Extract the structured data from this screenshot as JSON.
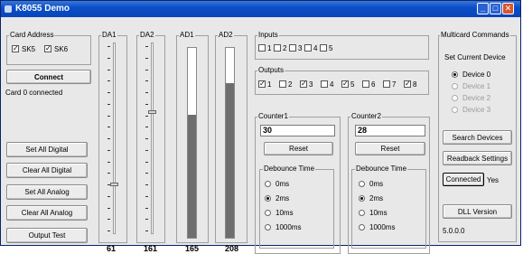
{
  "window": {
    "title": "K8055 Demo"
  },
  "card_address": {
    "label": "Card Address",
    "sk5": {
      "label": "SK5",
      "checked": true
    },
    "sk6": {
      "label": "SK6",
      "checked": true
    },
    "connect_label": "Connect",
    "status": "Card 0 connected"
  },
  "left_buttons": [
    "Set All Digital",
    "Clear All Digital",
    "Set All Analog",
    "Clear All Analog",
    "Output Test"
  ],
  "da1": {
    "label": "DA1",
    "value": "61",
    "level": 0.239
  },
  "da2": {
    "label": "DA2",
    "value": "161",
    "level": 0.631
  },
  "ad1": {
    "label": "AD1",
    "value": "165",
    "level": 0.647
  },
  "ad2": {
    "label": "AD2",
    "value": "208",
    "level": 0.816
  },
  "inputs": {
    "label": "Inputs",
    "items": [
      {
        "label": "1",
        "checked": false
      },
      {
        "label": "2",
        "checked": false
      },
      {
        "label": "3",
        "checked": false
      },
      {
        "label": "4",
        "checked": false
      },
      {
        "label": "5",
        "checked": false
      }
    ]
  },
  "outputs": {
    "label": "Outputs",
    "items": [
      {
        "label": "1",
        "checked": true
      },
      {
        "label": "2",
        "checked": false
      },
      {
        "label": "3",
        "checked": true
      },
      {
        "label": "4",
        "checked": false
      },
      {
        "label": "5",
        "checked": true
      },
      {
        "label": "6",
        "checked": false
      },
      {
        "label": "7",
        "checked": false
      },
      {
        "label": "8",
        "checked": true
      }
    ]
  },
  "counter1": {
    "label": "Counter1",
    "value": "30",
    "reset_label": "Reset",
    "debounce_label": "Debounce Time",
    "options": [
      "0ms",
      "2ms",
      "10ms",
      "1000ms"
    ],
    "selected": 1
  },
  "counter2": {
    "label": "Counter2",
    "value": "28",
    "reset_label": "Reset",
    "debounce_label": "Debounce Time",
    "options": [
      "0ms",
      "2ms",
      "10ms",
      "1000ms"
    ],
    "selected": 1
  },
  "multicard": {
    "label": "Multicard Commands",
    "set_current_label": "Set Current Device",
    "devices": [
      {
        "label": "Device 0",
        "selected": true,
        "enabled": true
      },
      {
        "label": "Device 1",
        "selected": false,
        "enabled": false
      },
      {
        "label": "Device 2",
        "selected": false,
        "enabled": false
      },
      {
        "label": "Device 3",
        "selected": false,
        "enabled": false
      }
    ],
    "search_label": "Search Devices",
    "readback_label": "Readback Settings",
    "connected_label": "Connected",
    "connected_value": "Yes",
    "dll_label": "DLL Version",
    "dll_value": "5.0.0.0"
  }
}
